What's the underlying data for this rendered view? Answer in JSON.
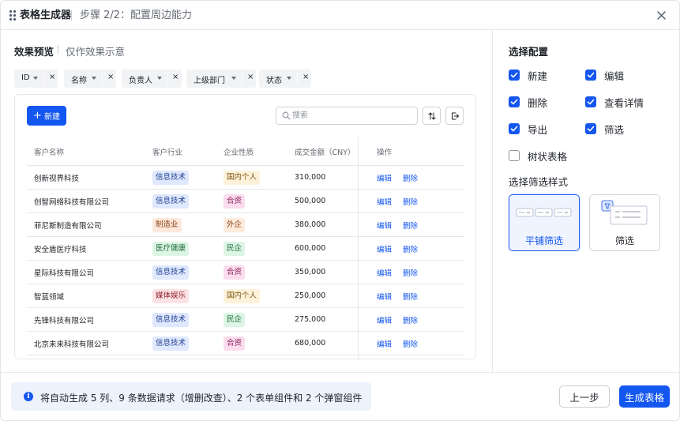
{
  "header": {
    "title": "表格生成器",
    "step": "步骤 2/2：配置周边能力"
  },
  "preview": {
    "title": "效果预览",
    "subtitle": "仅作效果示意",
    "chips": [
      {
        "label": "ID"
      },
      {
        "label": "名称"
      },
      {
        "label": "负责人"
      },
      {
        "label": "上级部门"
      },
      {
        "label": "状态"
      }
    ],
    "chip_close": "×",
    "toolbar": {
      "new_label": "新建",
      "search_placeholder": "搜索"
    },
    "table": {
      "columns": [
        "客户名称",
        "客户行业",
        "企业性质",
        "成交金额（CNY）",
        "操作"
      ],
      "rows": [
        {
          "name": "创新视界科技",
          "industry": "信息技术",
          "nature": "国内个人",
          "amount": "310,000"
        },
        {
          "name": "创智网络科技有限公司",
          "industry": "信息技术",
          "nature": "合资",
          "amount": "500,000"
        },
        {
          "name": "菲尼斯制造有限公司",
          "industry": "制造业",
          "nature": "外企",
          "amount": "380,000"
        },
        {
          "name": "安全盾医疗科技",
          "industry": "医疗健康",
          "nature": "民企",
          "amount": "600,000"
        },
        {
          "name": "星际科技有限公司",
          "industry": "信息技术",
          "nature": "合资",
          "amount": "350,000"
        },
        {
          "name": "智蓝领域",
          "industry": "媒体娱乐",
          "nature": "国内个人",
          "amount": "250,000"
        },
        {
          "name": "先锋科技有限公司",
          "industry": "信息技术",
          "nature": "民企",
          "amount": "275,000"
        },
        {
          "name": "北京未来科技有限公司",
          "industry": "信息技术",
          "nature": "合资",
          "amount": "680,000"
        }
      ],
      "op_edit": "编辑",
      "op_delete": "删除"
    },
    "tag_colors": {
      "信息技术": {
        "bg": "#dfe8fd",
        "fg": "#1f3f91"
      },
      "制造业": {
        "bg": "#fde9dc",
        "fg": "#8a4215"
      },
      "医疗健康": {
        "bg": "#dcf5e4",
        "fg": "#1e6b3a"
      },
      "媒体娱乐": {
        "bg": "#fde2e4",
        "fg": "#8e1f2c"
      },
      "国内个人": {
        "bg": "#fdf2d9",
        "fg": "#7a5510"
      },
      "合资": {
        "bg": "#fadcec",
        "fg": "#8a1f5c"
      },
      "外企": {
        "bg": "#fdebdc",
        "fg": "#8a4215"
      },
      "民企": {
        "bg": "#dcf5e4",
        "fg": "#1e6b3a"
      }
    }
  },
  "config": {
    "title": "选择配置",
    "options": [
      {
        "label": "新建",
        "checked": true
      },
      {
        "label": "编辑",
        "checked": true
      },
      {
        "label": "删除",
        "checked": true
      },
      {
        "label": "查看详情",
        "checked": true
      },
      {
        "label": "导出",
        "checked": true
      },
      {
        "label": "筛选",
        "checked": true
      },
      {
        "label": "树状表格",
        "checked": false
      }
    ],
    "filter_style_title": "选择筛选样式",
    "filter_styles": [
      {
        "label": "平铺筛选",
        "selected": true
      },
      {
        "label": "筛选",
        "selected": false
      }
    ]
  },
  "footer": {
    "notice": "将自动生成 5 列、9 条数据请求（增删改查）、2 个表单组件和 2 个弹窗组件",
    "prev_label": "上一步",
    "generate_label": "生成表格"
  },
  "colors": {
    "primary": "#1456f0",
    "notice_bg": "#eef2fd"
  }
}
